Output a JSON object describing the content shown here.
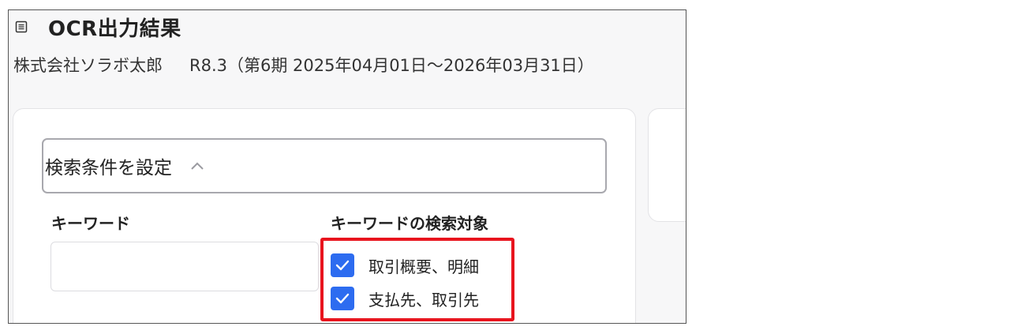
{
  "page": {
    "title": "OCR出力結果",
    "title_icon": "list-document-icon",
    "company": "株式会社ソラボ太郎",
    "period": "R8.3（第6期 2025年04月01日〜2026年03月31日）"
  },
  "search": {
    "header_label": "検索条件を設定",
    "header_icon": "chevron-up-icon",
    "keyword_label": "キーワード",
    "keyword_value": "",
    "target_label": "キーワードの検索対象",
    "targets": [
      {
        "label": "取引概要、明細",
        "checked": true
      },
      {
        "label": "支払先、取引先",
        "checked": true
      }
    ]
  },
  "colors": {
    "checkbox": "#2d6cf0",
    "highlight": "#e8141e",
    "card_border": "#e3e3e6",
    "frame_background": "#f7f7f8"
  }
}
